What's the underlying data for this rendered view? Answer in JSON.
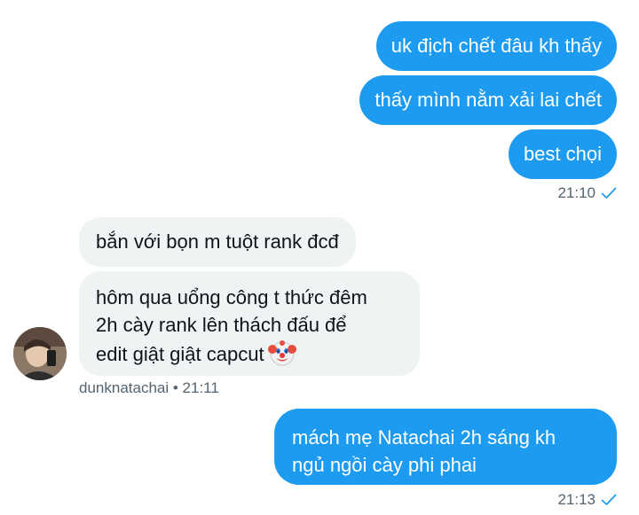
{
  "outgoing_top": [
    {
      "text": "uk địch chết đâu kh thấy"
    },
    {
      "text": "thấy mình nằm xải lai chết"
    },
    {
      "text": "best chọi"
    }
  ],
  "outgoing_top_time": "21:10",
  "incoming": {
    "messages": [
      {
        "text": "bắn với bọn m tuột rank đcđ"
      },
      {
        "lines": [
          "hôm qua uổng công t thức đêm",
          "2h cày rank lên thách đấu để",
          "edit giật giật capcut"
        ],
        "emoji": "clown-face-icon"
      }
    ],
    "meta": "dunknatachai • 21:11"
  },
  "outgoing_bottom": {
    "lines": [
      "mách mẹ Natachai 2h sáng kh",
      "ngủ ngồi cày phi phai"
    ],
    "time": "21:13"
  },
  "colors": {
    "outgoing_bubble": "#1d9bf0",
    "incoming_bubble": "#eff3f4",
    "meta_text": "#536471",
    "read_check": "#1d9bf0"
  }
}
